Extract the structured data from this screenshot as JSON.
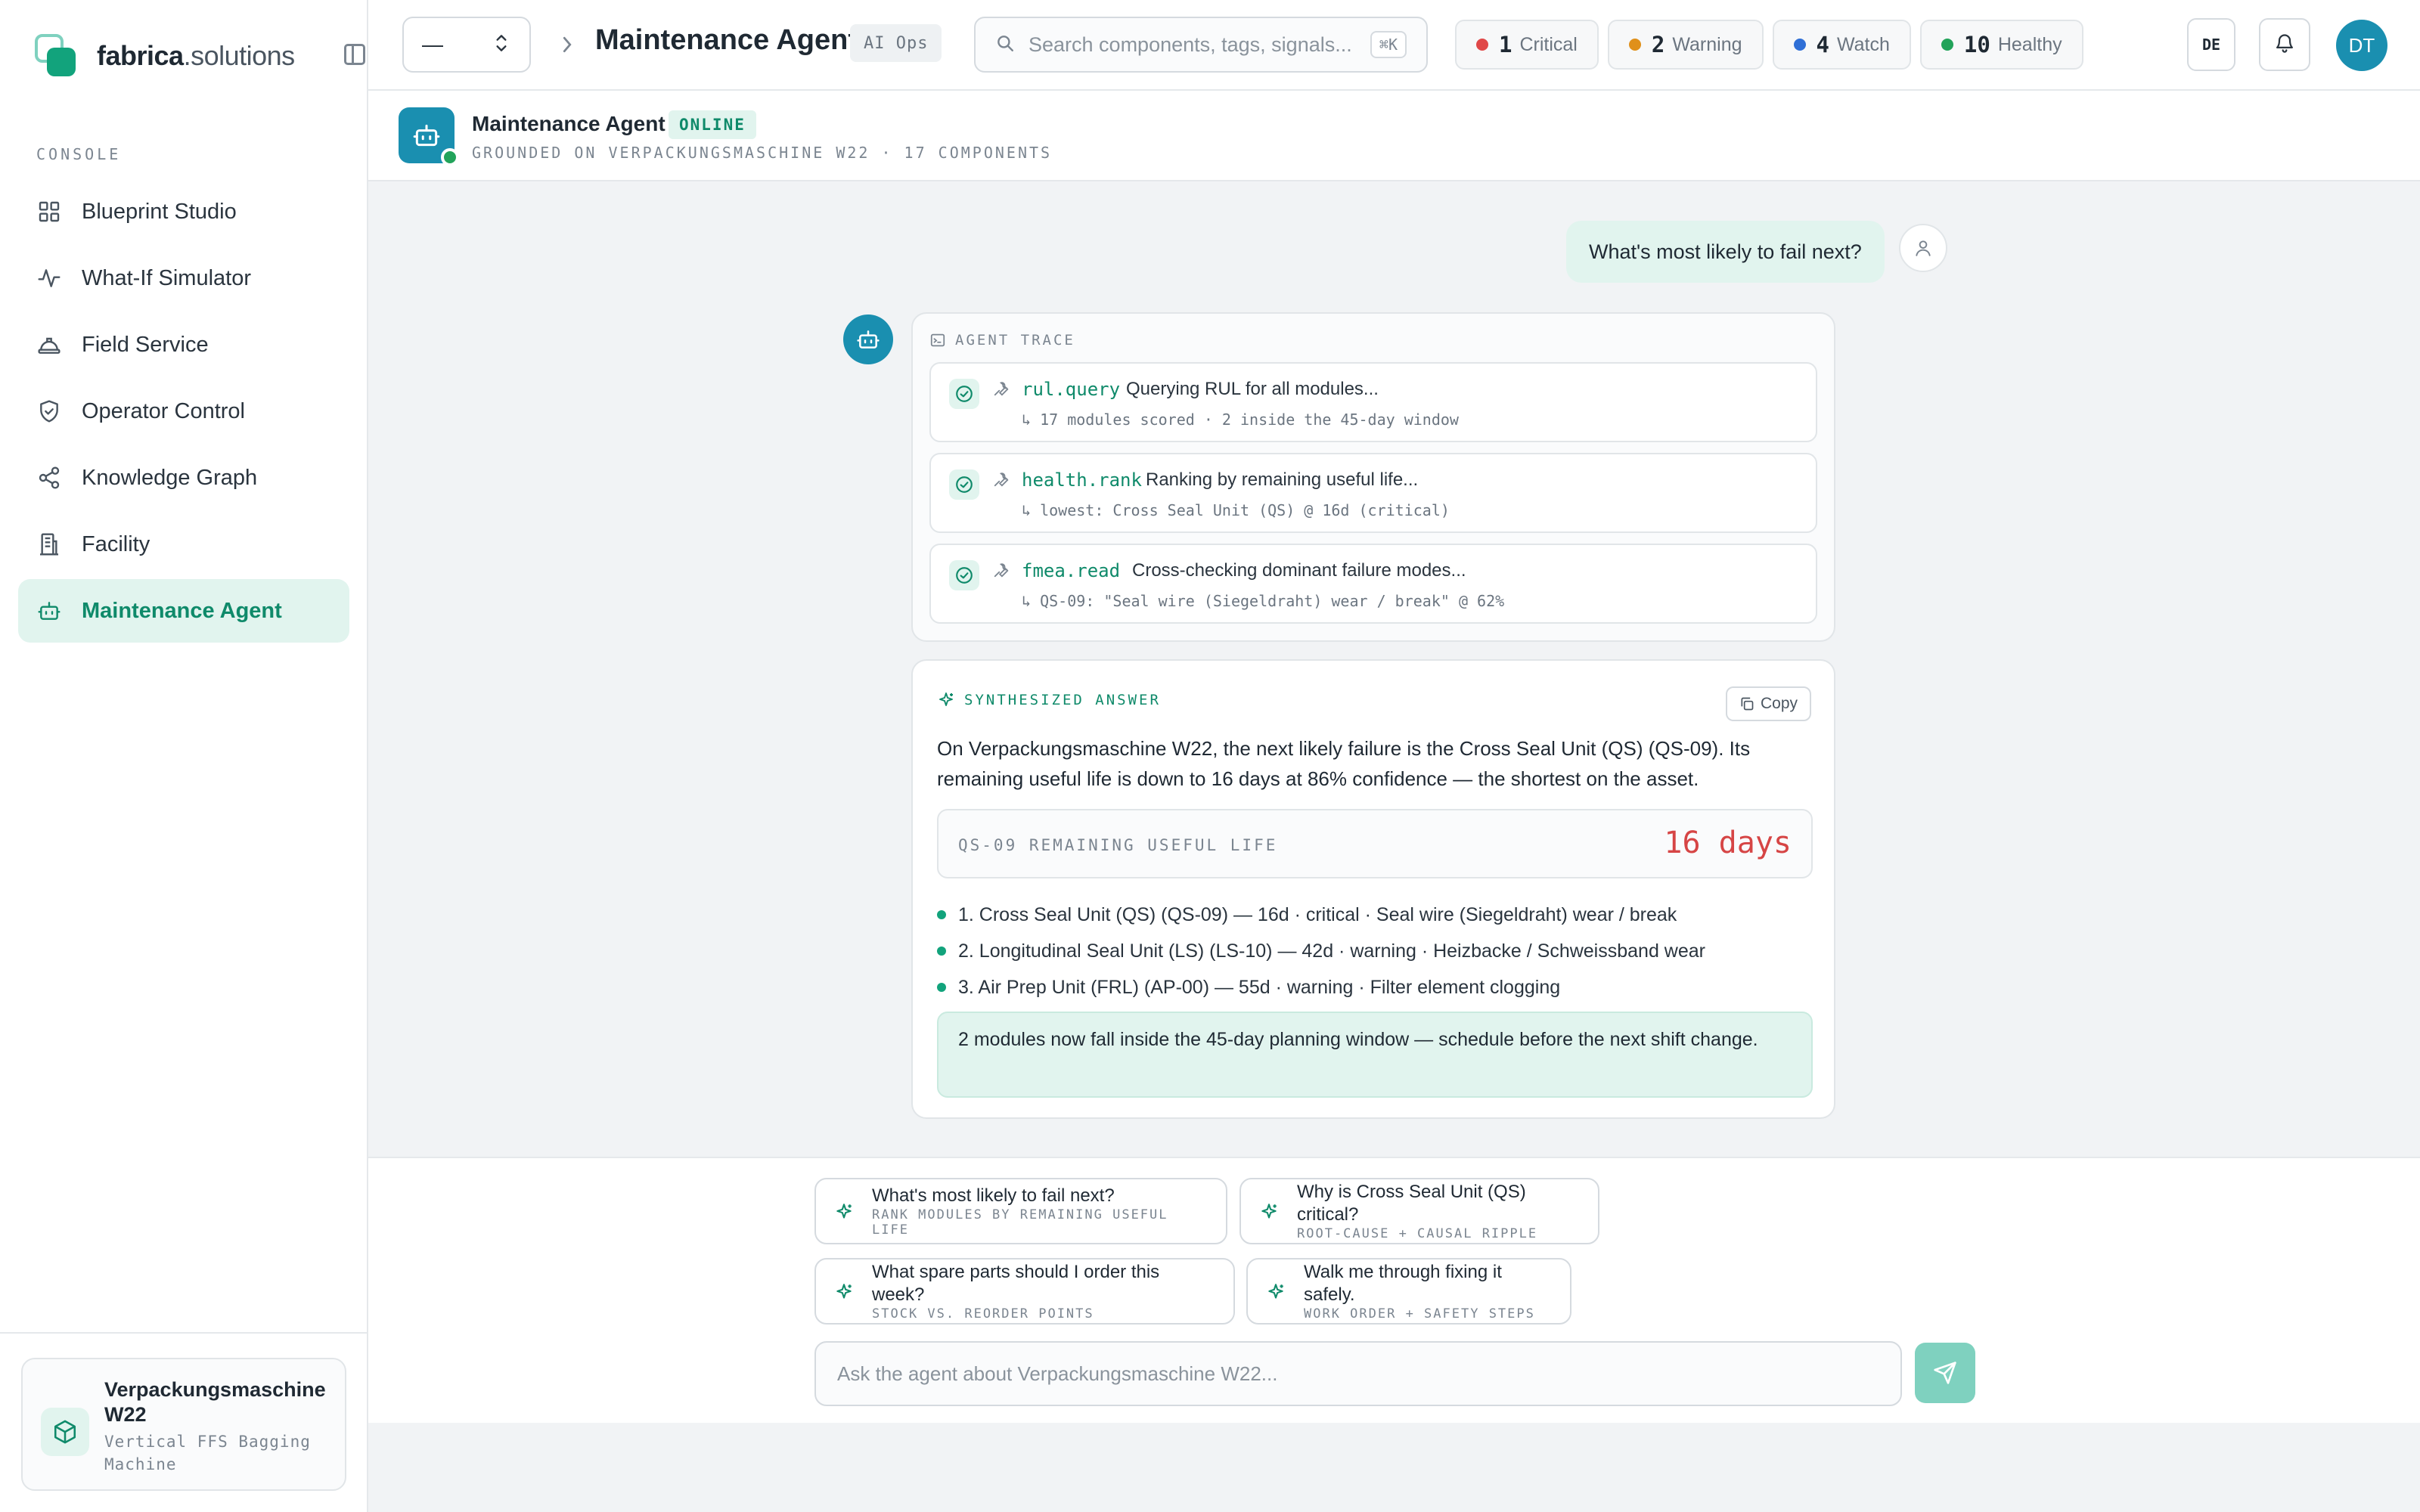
{
  "brand": {
    "name_bold": "fabrica",
    "name_rest": ".solutions"
  },
  "sidebar": {
    "section_label": "CONSOLE",
    "items": [
      {
        "label": "Blueprint Studio",
        "icon": "grid-icon",
        "active": false
      },
      {
        "label": "What-If Simulator",
        "icon": "pulse-icon",
        "active": false
      },
      {
        "label": "Field Service",
        "icon": "hardhat-icon",
        "active": false
      },
      {
        "label": "Operator Control",
        "icon": "shield-icon",
        "active": false
      },
      {
        "label": "Knowledge Graph",
        "icon": "share-nodes-icon",
        "active": false
      },
      {
        "label": "Facility",
        "icon": "building-icon",
        "active": false
      },
      {
        "label": "Maintenance Agent",
        "icon": "robot-icon",
        "active": true
      }
    ],
    "asset": {
      "title": "Verpackungsmaschine W22",
      "subtitle": "Vertical FFS Bagging Machine"
    }
  },
  "topbar": {
    "selector_value": "—",
    "title": "Maintenance Agent",
    "tag": "AI Ops",
    "search_placeholder": "Search components, tags, signals...",
    "search_kbd": "⌘K",
    "status": [
      {
        "count": "1",
        "label": "Critical",
        "color": "#e04848"
      },
      {
        "count": "2",
        "label": "Warning",
        "color": "#e0901a"
      },
      {
        "count": "4",
        "label": "Watch",
        "color": "#2f6fd6"
      },
      {
        "count": "10",
        "label": "Healthy",
        "color": "#22a35a"
      }
    ],
    "lang": "DE",
    "avatar_initials": "DT"
  },
  "agent": {
    "name": "Maintenance Agent",
    "status": "ONLINE",
    "subtitle": "GROUNDED ON VERPACKUNGSMASCHINE W22 · 17 COMPONENTS"
  },
  "chat": {
    "user_message": "What's most likely to fail next?",
    "trace_label": "AGENT TRACE",
    "trace_steps": [
      {
        "tool": "rul.query",
        "desc": "Querying RUL for all modules...",
        "result": "↳ 17 modules scored · 2 inside the 45-day window"
      },
      {
        "tool": "health.rank",
        "desc": "Ranking by remaining useful life...",
        "result": "↳ lowest: Cross Seal Unit (QS) @ 16d (critical)"
      },
      {
        "tool": "fmea.read",
        "desc": "Cross-checking dominant failure modes...",
        "result": "↳ QS-09: \"Seal wire (Siegeldraht) wear / break\" @ 62%"
      }
    ],
    "answer_label": "SYNTHESIZED ANSWER",
    "copy_label": "Copy",
    "answer_text": "On Verpackungsmaschine W22, the next likely failure is the Cross Seal Unit (QS) (QS-09). Its remaining useful life is down to 16 days at 86% confidence — the shortest on the asset.",
    "rul_label": "QS-09 REMAINING USEFUL LIFE",
    "rul_value": "16 days",
    "ranking": [
      "1. Cross Seal Unit (QS) (QS-09) — 16d · critical · Seal wire (Siegeldraht) wear / break",
      "2. Longitudinal Seal Unit (LS) (LS-10) — 42d · warning · Heizbacke / Schweissband wear",
      "3. Air Prep Unit (FRL) (AP-00) — 55d · warning · Filter element clogging"
    ],
    "note": "2 modules now fall inside the 45-day planning window — schedule before the next shift change."
  },
  "composer": {
    "suggestions": [
      {
        "title": "What's most likely to fail next?",
        "sub": "RANK MODULES BY REMAINING USEFUL LIFE"
      },
      {
        "title": "Why is Cross Seal Unit (QS) critical?",
        "sub": "ROOT-CAUSE + CAUSAL RIPPLE"
      },
      {
        "title": "What spare parts should I order this week?",
        "sub": "STOCK VS. REORDER POINTS"
      },
      {
        "title": "Walk me through fixing it safely.",
        "sub": "WORK ORDER + SAFETY STEPS"
      }
    ],
    "input_placeholder": "Ask the agent about Verpackungsmaschine W22..."
  }
}
